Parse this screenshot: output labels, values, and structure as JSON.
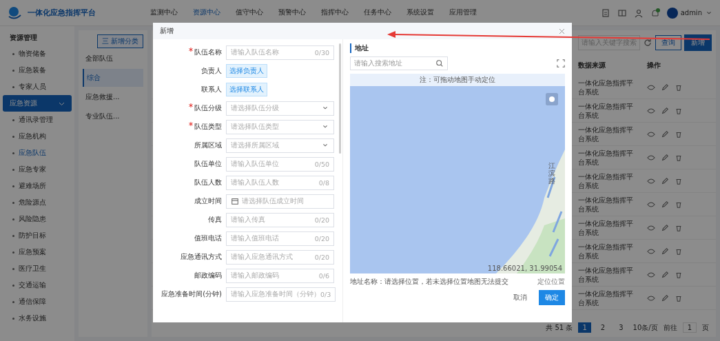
{
  "header": {
    "title": "一体化应急指挥平台",
    "nav": [
      {
        "label": "监测中心",
        "selected": false
      },
      {
        "label": "资源中心",
        "selected": true
      },
      {
        "label": "值守中心",
        "selected": false
      },
      {
        "label": "预警中心",
        "selected": false
      },
      {
        "label": "指挥中心",
        "selected": false
      },
      {
        "label": "任务中心",
        "selected": false
      },
      {
        "label": "系统设置",
        "selected": false
      },
      {
        "label": "应用管理",
        "selected": false
      }
    ],
    "user": "admin"
  },
  "sidebar": {
    "title": "资源管理",
    "items": [
      {
        "label": "物资储备",
        "selected": false
      },
      {
        "label": "应急装备",
        "selected": false
      },
      {
        "label": "专家人员",
        "selected": false
      },
      {
        "label": "应急资源",
        "selected": true,
        "expanded": true,
        "children": [
          {
            "label": "通讯录管理",
            "selected": false
          },
          {
            "label": "应急机构",
            "selected": false
          },
          {
            "label": "应急队伍",
            "selected": true
          },
          {
            "label": "应急专家",
            "selected": false
          },
          {
            "label": "避难场所",
            "selected": false
          },
          {
            "label": "危险源点",
            "selected": false
          },
          {
            "label": "风险隐患",
            "selected": false
          },
          {
            "label": "防护目标",
            "selected": false
          },
          {
            "label": "应急预案",
            "selected": false
          },
          {
            "label": "医疗卫生",
            "selected": false
          },
          {
            "label": "交通运输",
            "selected": false
          },
          {
            "label": "通信保障",
            "selected": false
          },
          {
            "label": "水务设施",
            "selected": false
          }
        ]
      }
    ]
  },
  "categories": {
    "button": "三 新增分类",
    "items": [
      {
        "label": "全部队伍",
        "selected": false
      },
      {
        "label": "综合",
        "selected": true
      },
      {
        "label": "应急救援...",
        "selected": false
      },
      {
        "label": "专业队伍...",
        "selected": false
      }
    ]
  },
  "table": {
    "search_placeholder": "请输入关键字搜索",
    "query_button": "查询",
    "add_button": "新增",
    "columns": [
      "数据来源",
      "操作"
    ],
    "rows": [
      {
        "source": "一体化应急指挥平台系统"
      },
      {
        "source": "一体化应急指挥平台系统"
      },
      {
        "source": "一体化应急指挥平台系统"
      },
      {
        "source": "一体化应急指挥平台系统"
      },
      {
        "source": "一体化应急指挥平台系统"
      },
      {
        "source": "一体化应急指挥平台系统"
      },
      {
        "source": "一体化应急指挥平台系统"
      },
      {
        "source": "一体化应急指挥平台系统"
      },
      {
        "source": "一体化应急指挥平台系统"
      },
      {
        "source": "一体化应急指挥平台系统"
      }
    ],
    "pagination": {
      "total": "共 51 条",
      "pages": [
        {
          "label": "1",
          "selected": true
        },
        {
          "label": "2",
          "selected": false
        },
        {
          "label": "3",
          "selected": false
        }
      ],
      "page_size": "10条/页",
      "goto_label": "前往",
      "goto_value": "1",
      "goto_suffix": "页"
    }
  },
  "modal": {
    "title": "新增",
    "form": [
      {
        "kind": "input",
        "label": "队伍名称",
        "required": true,
        "placeholder": "请输入队伍名称",
        "counter": "0/30"
      },
      {
        "kind": "picker",
        "label": "负责人",
        "required": false,
        "placeholder": "选择负责人"
      },
      {
        "kind": "picker",
        "label": "联系人",
        "required": false,
        "placeholder": "选择联系人"
      },
      {
        "kind": "select",
        "label": "队伍分级",
        "required": true,
        "placeholder": "请选择队伍分级"
      },
      {
        "kind": "select",
        "label": "队伍类型",
        "required": true,
        "placeholder": "请选择队伍类型"
      },
      {
        "kind": "select",
        "label": "所属区域",
        "required": false,
        "placeholder": "请选择所属区域"
      },
      {
        "kind": "input",
        "label": "队伍单位",
        "required": false,
        "placeholder": "请输入队伍单位",
        "counter": "0/50"
      },
      {
        "kind": "input",
        "label": "队伍人数",
        "required": false,
        "placeholder": "请输入队伍人数",
        "counter": "0/8"
      },
      {
        "kind": "date",
        "label": "成立时间",
        "required": false,
        "placeholder": "请选择队伍成立时间"
      },
      {
        "kind": "input",
        "label": "传真",
        "required": false,
        "placeholder": "请输入传真",
        "counter": "0/20"
      },
      {
        "kind": "input",
        "label": "值班电话",
        "required": false,
        "placeholder": "请输入值班电话",
        "counter": "0/20"
      },
      {
        "kind": "input",
        "label": "应急通讯方式",
        "required": false,
        "placeholder": "请输入应急通讯方式",
        "counter": "0/20"
      },
      {
        "kind": "input",
        "label": "邮政编码",
        "required": false,
        "placeholder": "请输入邮政编码",
        "counter": "0/6"
      },
      {
        "kind": "input",
        "label": "应急准备时间(分钟)",
        "required": false,
        "placeholder": "请输入应急准备时间（分钟）",
        "counter": "0/3"
      }
    ],
    "address": {
      "title": "地址",
      "search_placeholder": "请输入搜索地址",
      "hint": "注：可拖动地图手动定位",
      "road_label": "江滨路",
      "coordinates": "118.66021, 31.99054",
      "address_text": "地址名称：请选择位置，若未选择位置地图无法提交",
      "locate_button": "定位位置"
    },
    "buttons": [
      {
        "label": "取消",
        "kind": "secondary"
      },
      {
        "label": "确定",
        "kind": "primary"
      }
    ]
  }
}
